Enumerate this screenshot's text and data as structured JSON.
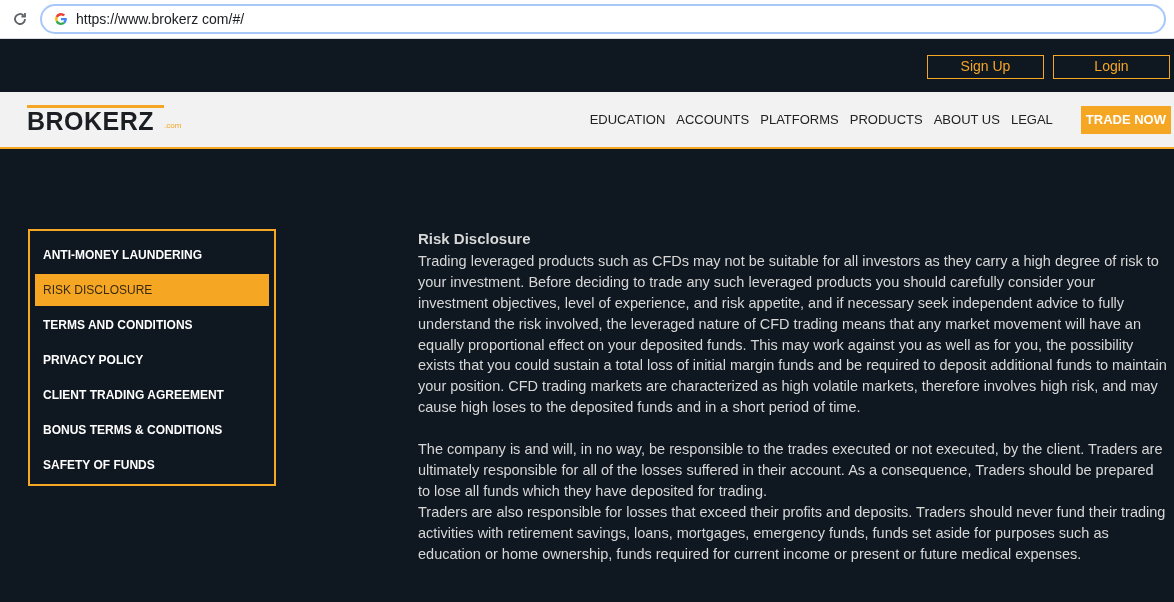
{
  "browser": {
    "url": "https://www.brokerz com/#/"
  },
  "top_bar": {
    "buttons": [
      "Sign Up",
      "Login"
    ]
  },
  "nav": {
    "logo": {
      "name": "BROKERZ",
      "suffix": ".com"
    },
    "items": [
      "EDUCATION",
      "ACCOUNTS",
      "PLATFORMS",
      "PRODUCTS",
      "ABOUT US",
      "LEGAL"
    ],
    "cta": "TRADE NOW"
  },
  "sidebar": {
    "items": [
      {
        "label": "ANTI-MONEY LAUNDERING",
        "selected": false
      },
      {
        "label": "RISK DISCLOSURE",
        "selected": true
      },
      {
        "label": "TERMS AND CONDITIONS",
        "selected": false
      },
      {
        "label": "PRIVACY POLICY",
        "selected": false
      },
      {
        "label": "CLIENT TRADING AGREEMENT",
        "selected": false
      },
      {
        "label": "BONUS TERMS & CONDITIONS",
        "selected": false
      },
      {
        "label": "SAFETY OF FUNDS",
        "selected": false
      }
    ]
  },
  "content": {
    "title": "Risk Disclosure",
    "sections": [
      [
        "Trading leveraged products such as CFDs may not be suitable for all investors as they carry a high degree of risk to your investment. Before deciding to trade any such leveraged products you should carefully consider your investment objectives, level of experience, and risk appetite, and if necessary seek independent advice to fully understand the risk involved, the leveraged nature of CFD trading means that any market movement will have an equally proportional effect on your deposited funds. This may work against you as well as for you, the possibility exists that you could sustain a total loss of initial margin funds and be required to deposit additional funds to maintain your position. CFD trading markets are characterized as high volatile markets, therefore involves high risk, and may cause high loses to the deposited funds and in a short period of time."
      ],
      [
        "The company is and will, in no way, be responsible to the trades executed or not executed, by the client. Traders are ultimately responsible for all of the losses suffered in their account. As a consequence, Traders should be prepared to lose all funds which they have deposited for trading.",
        "Traders are also responsible for losses that exceed their profits and deposits. Traders should never fund their trading activities with retirement savings, loans, mortgages, emergency funds, funds set aside for purposes such as education or home ownership, funds required for current income or present or future medical expenses."
      ]
    ]
  }
}
